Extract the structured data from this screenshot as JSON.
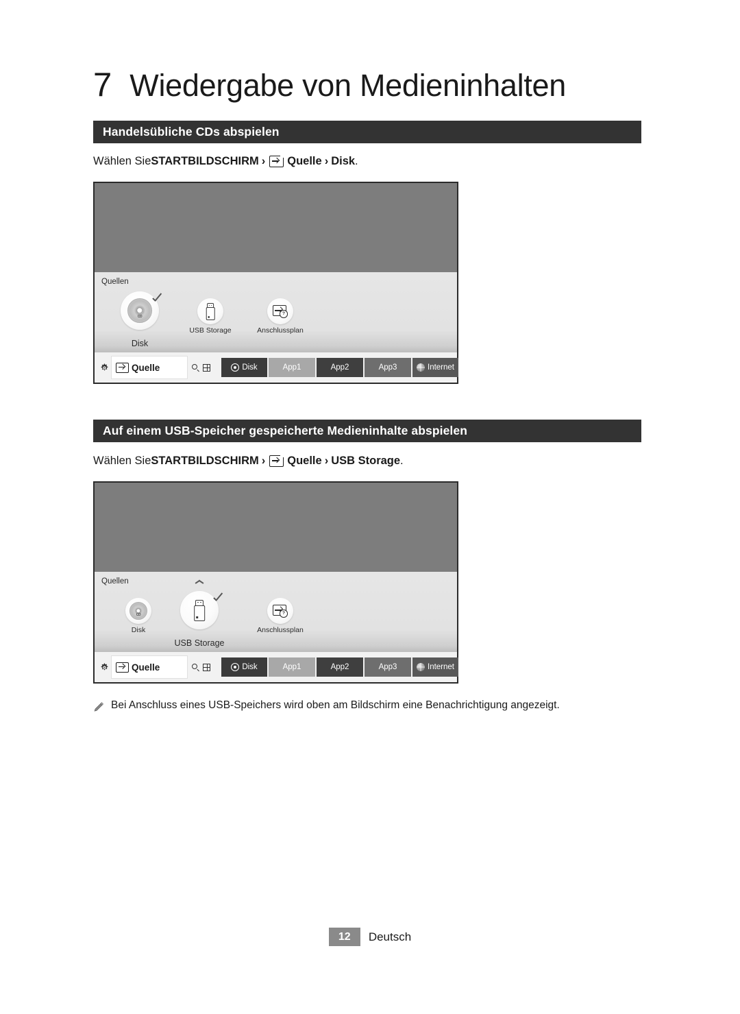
{
  "chapter": {
    "number": "7",
    "title": "Wiedergabe von Medieninhalten"
  },
  "sections": [
    {
      "heading": "Handelsübliche CDs abspielen",
      "instruction": {
        "prefix": "Wählen Sie ",
        "step1": "STARTBILDSCHIRM",
        "sep1": "›",
        "icon": "source-icon",
        "step2": "Quelle",
        "sep2": "›",
        "step3": "Disk",
        "suffix": "."
      },
      "screen": {
        "panel_title": "Quellen",
        "sources": [
          {
            "label": "Disk",
            "icon": "disc-icon",
            "selected": true
          },
          {
            "label": "USB Storage",
            "icon": "usb-drive-icon",
            "selected": false
          },
          {
            "label": "Anschlussplan",
            "icon": "connection-guide-icon",
            "selected": false
          }
        ],
        "bottom_bar": {
          "gear": "gear-icon",
          "source_icon": "source-icon",
          "source_label": "Quelle",
          "search_icon": "search-icon",
          "grid_icon": "grid-icon",
          "tiles": [
            {
              "label": "Disk",
              "icon": "disk-icon",
              "shade": "#3b3b3b"
            },
            {
              "label": "App1",
              "icon": "",
              "shade": "#a8a8a8"
            },
            {
              "label": "App2",
              "icon": "",
              "shade": "#3f3f3f"
            },
            {
              "label": "App3",
              "icon": "",
              "shade": "#6e6e6e"
            },
            {
              "label": "Internet",
              "icon": "globe-icon",
              "shade": "#585858"
            }
          ]
        }
      }
    },
    {
      "heading": "Auf einem USB-Speicher gespeicherte Medieninhalte abspielen",
      "instruction": {
        "prefix": "Wählen Sie ",
        "step1": "STARTBILDSCHIRM",
        "sep1": "›",
        "icon": "source-icon",
        "step2": "Quelle",
        "sep2": "›",
        "step3": "USB Storage",
        "suffix": "."
      },
      "screen": {
        "panel_title": "Quellen",
        "sources": [
          {
            "label": "Disk",
            "icon": "disc-icon",
            "selected": false
          },
          {
            "label": "USB Storage",
            "icon": "usb-drive-icon",
            "selected": true
          },
          {
            "label": "Anschlussplan",
            "icon": "connection-guide-icon",
            "selected": false
          }
        ],
        "bottom_bar": {
          "gear": "gear-icon",
          "source_icon": "source-icon",
          "source_label": "Quelle",
          "search_icon": "search-icon",
          "grid_icon": "grid-icon",
          "tiles": [
            {
              "label": "Disk",
              "icon": "disk-icon",
              "shade": "#3b3b3b"
            },
            {
              "label": "App1",
              "icon": "",
              "shade": "#a8a8a8"
            },
            {
              "label": "App2",
              "icon": "",
              "shade": "#3f3f3f"
            },
            {
              "label": "App3",
              "icon": "",
              "shade": "#6e6e6e"
            },
            {
              "label": "Internet",
              "icon": "globe-icon",
              "shade": "#585858"
            }
          ]
        }
      }
    }
  ],
  "note": {
    "icon": "pencil-icon",
    "text": "Bei Anschluss eines USB-Speichers wird oben am Bildschirm eine Benachrichtigung angezeigt."
  },
  "footer": {
    "page_number": "12",
    "language": "Deutsch"
  },
  "colors": {
    "header_bar": "#333333",
    "screen_top": "#7d7d7d",
    "screen_panel": "#e4e4e4",
    "page_badge": "#8a8a8a",
    "text": "#1a1a1a"
  }
}
